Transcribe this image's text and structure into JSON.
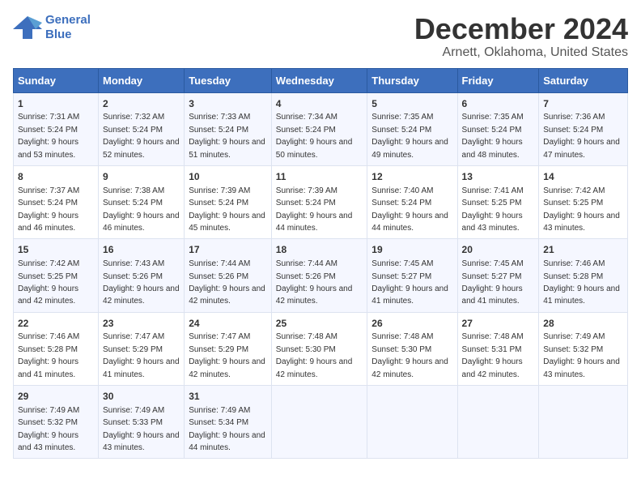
{
  "header": {
    "logo_line1": "General",
    "logo_line2": "Blue",
    "main_title": "December 2024",
    "subtitle": "Arnett, Oklahoma, United States"
  },
  "calendar": {
    "days_of_week": [
      "Sunday",
      "Monday",
      "Tuesday",
      "Wednesday",
      "Thursday",
      "Friday",
      "Saturday"
    ],
    "weeks": [
      [
        {
          "day": "1",
          "sunrise": "Sunrise: 7:31 AM",
          "sunset": "Sunset: 5:24 PM",
          "daylight": "Daylight: 9 hours and 53 minutes."
        },
        {
          "day": "2",
          "sunrise": "Sunrise: 7:32 AM",
          "sunset": "Sunset: 5:24 PM",
          "daylight": "Daylight: 9 hours and 52 minutes."
        },
        {
          "day": "3",
          "sunrise": "Sunrise: 7:33 AM",
          "sunset": "Sunset: 5:24 PM",
          "daylight": "Daylight: 9 hours and 51 minutes."
        },
        {
          "day": "4",
          "sunrise": "Sunrise: 7:34 AM",
          "sunset": "Sunset: 5:24 PM",
          "daylight": "Daylight: 9 hours and 50 minutes."
        },
        {
          "day": "5",
          "sunrise": "Sunrise: 7:35 AM",
          "sunset": "Sunset: 5:24 PM",
          "daylight": "Daylight: 9 hours and 49 minutes."
        },
        {
          "day": "6",
          "sunrise": "Sunrise: 7:35 AM",
          "sunset": "Sunset: 5:24 PM",
          "daylight": "Daylight: 9 hours and 48 minutes."
        },
        {
          "day": "7",
          "sunrise": "Sunrise: 7:36 AM",
          "sunset": "Sunset: 5:24 PM",
          "daylight": "Daylight: 9 hours and 47 minutes."
        }
      ],
      [
        {
          "day": "8",
          "sunrise": "Sunrise: 7:37 AM",
          "sunset": "Sunset: 5:24 PM",
          "daylight": "Daylight: 9 hours and 46 minutes."
        },
        {
          "day": "9",
          "sunrise": "Sunrise: 7:38 AM",
          "sunset": "Sunset: 5:24 PM",
          "daylight": "Daylight: 9 hours and 46 minutes."
        },
        {
          "day": "10",
          "sunrise": "Sunrise: 7:39 AM",
          "sunset": "Sunset: 5:24 PM",
          "daylight": "Daylight: 9 hours and 45 minutes."
        },
        {
          "day": "11",
          "sunrise": "Sunrise: 7:39 AM",
          "sunset": "Sunset: 5:24 PM",
          "daylight": "Daylight: 9 hours and 44 minutes."
        },
        {
          "day": "12",
          "sunrise": "Sunrise: 7:40 AM",
          "sunset": "Sunset: 5:24 PM",
          "daylight": "Daylight: 9 hours and 44 minutes."
        },
        {
          "day": "13",
          "sunrise": "Sunrise: 7:41 AM",
          "sunset": "Sunset: 5:25 PM",
          "daylight": "Daylight: 9 hours and 43 minutes."
        },
        {
          "day": "14",
          "sunrise": "Sunrise: 7:42 AM",
          "sunset": "Sunset: 5:25 PM",
          "daylight": "Daylight: 9 hours and 43 minutes."
        }
      ],
      [
        {
          "day": "15",
          "sunrise": "Sunrise: 7:42 AM",
          "sunset": "Sunset: 5:25 PM",
          "daylight": "Daylight: 9 hours and 42 minutes."
        },
        {
          "day": "16",
          "sunrise": "Sunrise: 7:43 AM",
          "sunset": "Sunset: 5:26 PM",
          "daylight": "Daylight: 9 hours and 42 minutes."
        },
        {
          "day": "17",
          "sunrise": "Sunrise: 7:44 AM",
          "sunset": "Sunset: 5:26 PM",
          "daylight": "Daylight: 9 hours and 42 minutes."
        },
        {
          "day": "18",
          "sunrise": "Sunrise: 7:44 AM",
          "sunset": "Sunset: 5:26 PM",
          "daylight": "Daylight: 9 hours and 42 minutes."
        },
        {
          "day": "19",
          "sunrise": "Sunrise: 7:45 AM",
          "sunset": "Sunset: 5:27 PM",
          "daylight": "Daylight: 9 hours and 41 minutes."
        },
        {
          "day": "20",
          "sunrise": "Sunrise: 7:45 AM",
          "sunset": "Sunset: 5:27 PM",
          "daylight": "Daylight: 9 hours and 41 minutes."
        },
        {
          "day": "21",
          "sunrise": "Sunrise: 7:46 AM",
          "sunset": "Sunset: 5:28 PM",
          "daylight": "Daylight: 9 hours and 41 minutes."
        }
      ],
      [
        {
          "day": "22",
          "sunrise": "Sunrise: 7:46 AM",
          "sunset": "Sunset: 5:28 PM",
          "daylight": "Daylight: 9 hours and 41 minutes."
        },
        {
          "day": "23",
          "sunrise": "Sunrise: 7:47 AM",
          "sunset": "Sunset: 5:29 PM",
          "daylight": "Daylight: 9 hours and 41 minutes."
        },
        {
          "day": "24",
          "sunrise": "Sunrise: 7:47 AM",
          "sunset": "Sunset: 5:29 PM",
          "daylight": "Daylight: 9 hours and 42 minutes."
        },
        {
          "day": "25",
          "sunrise": "Sunrise: 7:48 AM",
          "sunset": "Sunset: 5:30 PM",
          "daylight": "Daylight: 9 hours and 42 minutes."
        },
        {
          "day": "26",
          "sunrise": "Sunrise: 7:48 AM",
          "sunset": "Sunset: 5:30 PM",
          "daylight": "Daylight: 9 hours and 42 minutes."
        },
        {
          "day": "27",
          "sunrise": "Sunrise: 7:48 AM",
          "sunset": "Sunset: 5:31 PM",
          "daylight": "Daylight: 9 hours and 42 minutes."
        },
        {
          "day": "28",
          "sunrise": "Sunrise: 7:49 AM",
          "sunset": "Sunset: 5:32 PM",
          "daylight": "Daylight: 9 hours and 43 minutes."
        }
      ],
      [
        {
          "day": "29",
          "sunrise": "Sunrise: 7:49 AM",
          "sunset": "Sunset: 5:32 PM",
          "daylight": "Daylight: 9 hours and 43 minutes."
        },
        {
          "day": "30",
          "sunrise": "Sunrise: 7:49 AM",
          "sunset": "Sunset: 5:33 PM",
          "daylight": "Daylight: 9 hours and 43 minutes."
        },
        {
          "day": "31",
          "sunrise": "Sunrise: 7:49 AM",
          "sunset": "Sunset: 5:34 PM",
          "daylight": "Daylight: 9 hours and 44 minutes."
        },
        {
          "day": "",
          "sunrise": "",
          "sunset": "",
          "daylight": ""
        },
        {
          "day": "",
          "sunrise": "",
          "sunset": "",
          "daylight": ""
        },
        {
          "day": "",
          "sunrise": "",
          "sunset": "",
          "daylight": ""
        },
        {
          "day": "",
          "sunrise": "",
          "sunset": "",
          "daylight": ""
        }
      ]
    ]
  }
}
